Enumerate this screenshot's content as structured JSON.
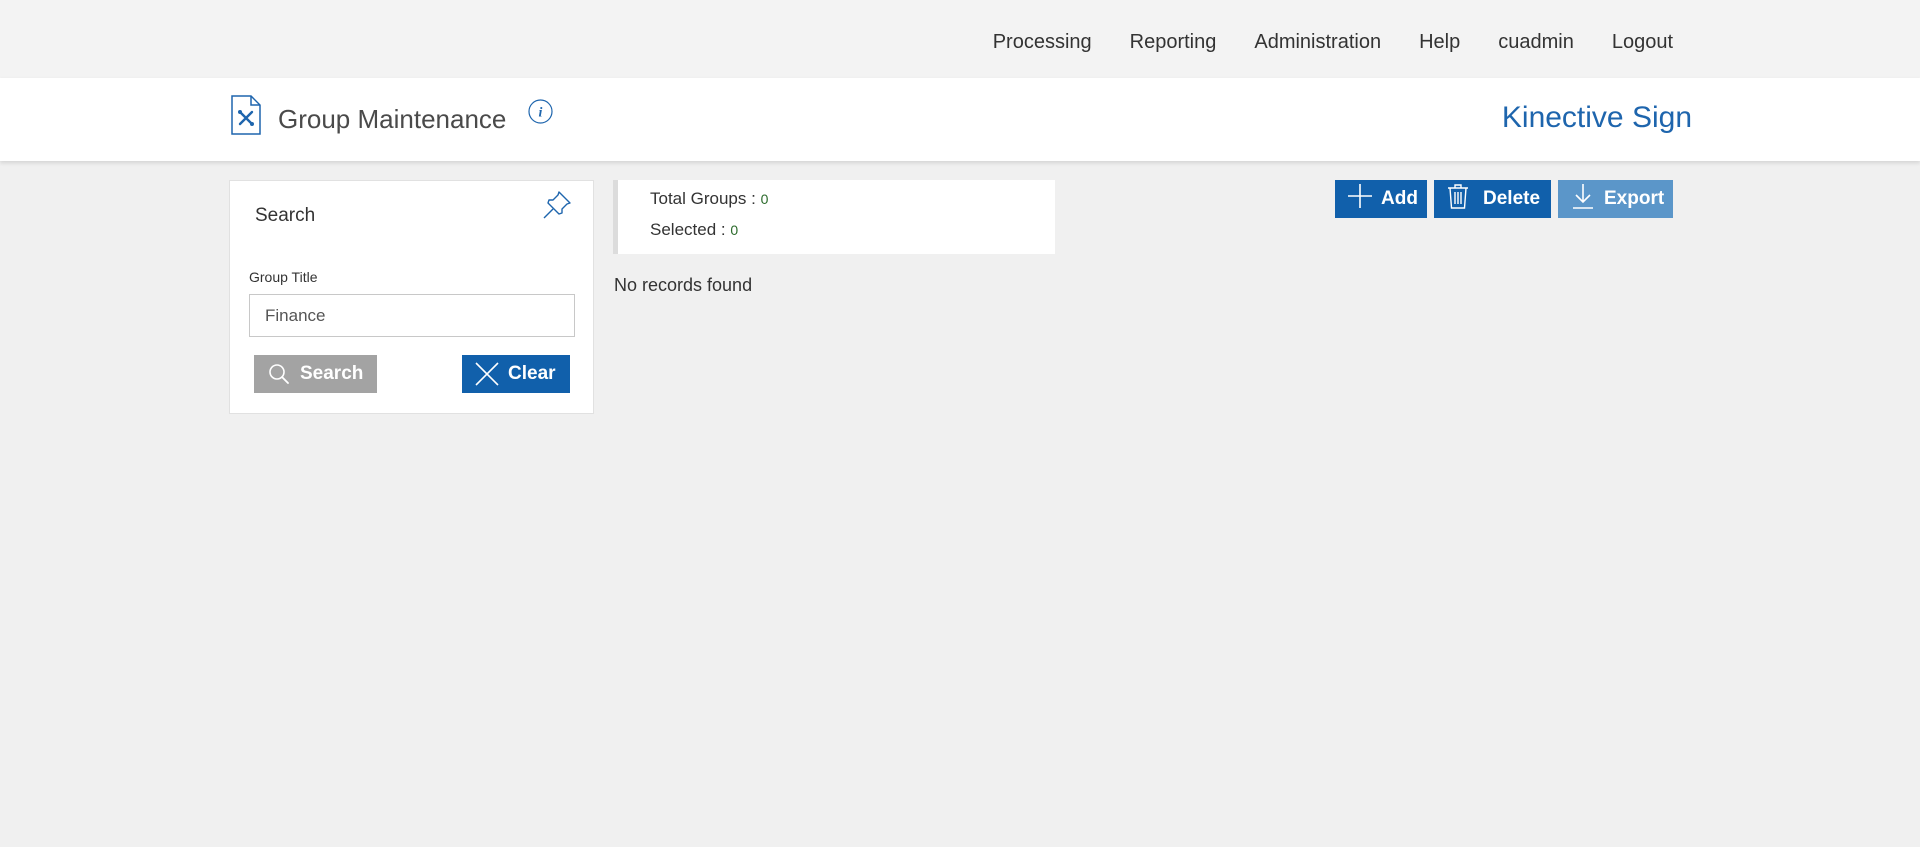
{
  "topnav": {
    "items": [
      "Processing",
      "Reporting",
      "Administration",
      "Help",
      "cuadmin",
      "Logout"
    ]
  },
  "header": {
    "title": "Group Maintenance",
    "brand": "Kinective Sign",
    "page_icon": "document-tools-icon",
    "info_icon": "info-icon"
  },
  "search": {
    "heading": "Search",
    "field_label": "Group Title",
    "field_value": "Finance",
    "search_button": "Search",
    "clear_button": "Clear"
  },
  "summary": {
    "total_label": "Total Groups : ",
    "total_value": "0",
    "selected_label": "Selected : ",
    "selected_value": "0"
  },
  "results": {
    "empty_text": "No records found"
  },
  "toolbar": {
    "add_label": "Add",
    "delete_label": "Delete",
    "export_label": "Export"
  },
  "colors": {
    "accent": "#1160ab",
    "brand": "#1e65ad",
    "disabled": "#a3a3a3",
    "export": "#5b96c9"
  }
}
